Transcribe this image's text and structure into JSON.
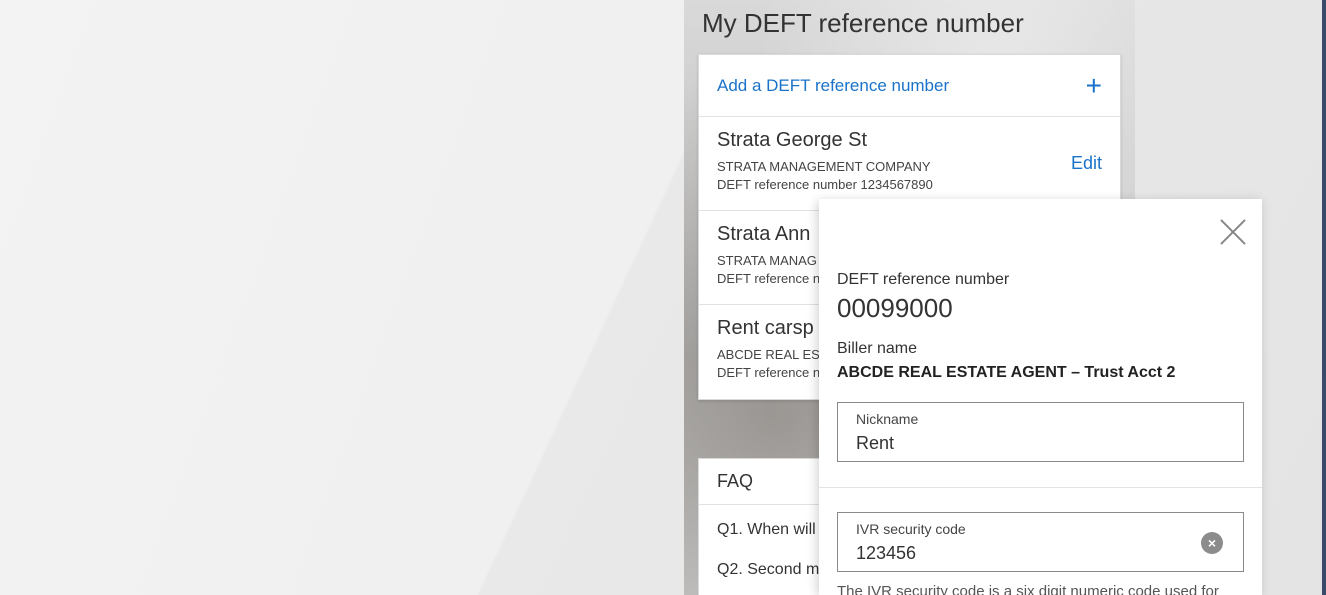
{
  "page": {
    "title": "My DEFT reference number"
  },
  "list": {
    "add_label": "Add a DEFT reference number",
    "add_icon": "plus-icon",
    "edit_label": "Edit",
    "entries": [
      {
        "name": "Strata George St",
        "biller": "STRATA MANAGEMENT COMPANY",
        "ref": "DEFT reference number 1234567890"
      },
      {
        "name": "Strata Ann",
        "biller": "STRATA MANAG",
        "ref": "DEFT reference n"
      },
      {
        "name": "Rent carsp",
        "biller": "ABCDE REAL ES",
        "ref": "DEFT reference n"
      }
    ]
  },
  "faq": {
    "title": "FAQ",
    "questions": [
      "Q1. When will",
      "Q2. Second m"
    ]
  },
  "modal": {
    "ref_label": "DEFT reference number",
    "ref_value": "00099000",
    "biller_label": "Biller name",
    "biller_value": "ABCDE REAL ESTATE AGENT – Trust Acct 2",
    "nickname_label": "Nickname",
    "nickname_value": "Rent",
    "ivr_label": "IVR security code",
    "ivr_value": "123456",
    "ivr_help": "The IVR security code is a six digit numeric code used for",
    "close_icon": "close-icon",
    "clear_icon": "clear-icon"
  },
  "colors": {
    "accent": "#1a73c9",
    "text": "#333333"
  }
}
